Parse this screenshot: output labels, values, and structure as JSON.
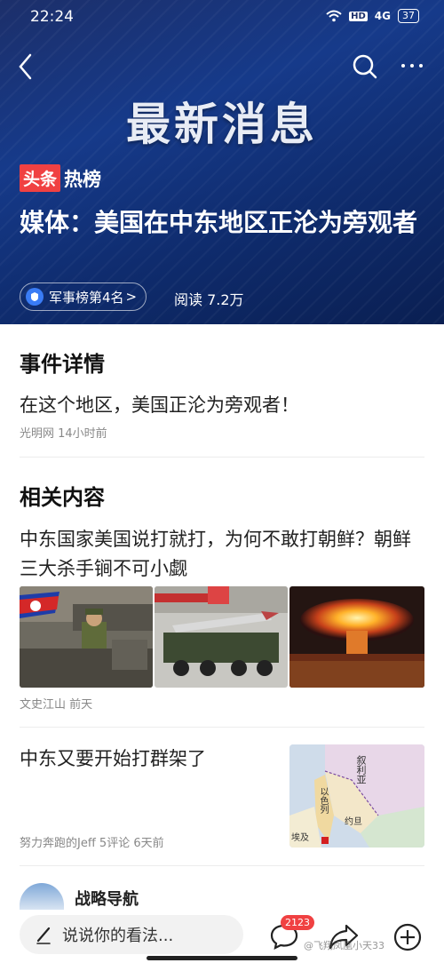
{
  "status": {
    "time": "22:24",
    "network": "HD",
    "signal": "4G",
    "battery": "37"
  },
  "hero": {
    "banner_title": "最新消息",
    "logo_red": "头条",
    "logo_text": "热榜",
    "headline": "媒体：美国在中东地区正沦为旁观者",
    "rank_label": "军事榜第4名",
    "rank_chevron": ">",
    "reads": "阅读 7.2万"
  },
  "event": {
    "section_title": "事件详情",
    "title": "在这个地区，美国正沦为旁观者！",
    "meta": "光明网   14小时前"
  },
  "related": {
    "section_title": "相关内容",
    "items": [
      {
        "title": "中东国家美国说打就打，为何不敢打朝鲜？朝鲜三大杀手锏不可小觑",
        "meta": "文史江山   前天"
      },
      {
        "title": "中东又要开始打群架了",
        "meta": "努力奔跑的Jeff   5评论   6天前"
      }
    ],
    "next_title": "战略导航",
    "map_labels": [
      "叙利亚",
      "以色列",
      "约旦",
      "埃及"
    ]
  },
  "bottom": {
    "comment_placeholder": "说说你的看法...",
    "comment_count": "2123",
    "watermark": "@飞翔凤凰小天33"
  },
  "colors": {
    "accent_red": "#f04142",
    "hero_blue": "#163a8a"
  }
}
